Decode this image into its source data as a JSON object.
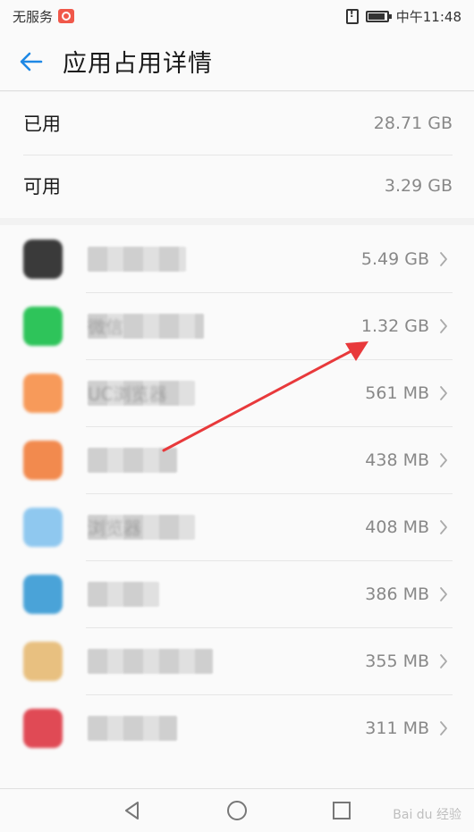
{
  "status_bar": {
    "carrier": "无服务",
    "time": "中午11:48"
  },
  "header": {
    "title": "应用占用详情"
  },
  "storage": [
    {
      "label": "已用",
      "value": "28.71 GB"
    },
    {
      "label": "可用",
      "value": "3.29 GB"
    }
  ],
  "apps": [
    {
      "name": "",
      "size": "5.49 GB",
      "icon_color": "#3a3a3a",
      "icon_name": "qq-icon",
      "blur_width": 110
    },
    {
      "name": "微信",
      "size": "1.32 GB",
      "icon_color": "#2ec45a",
      "icon_name": "wechat-icon",
      "blur_width": 130
    },
    {
      "name": "UC浏览器",
      "size": "561 MB",
      "icon_color": "#f79a5a",
      "icon_name": "browser-icon",
      "blur_width": 120
    },
    {
      "name": "",
      "size": "438 MB",
      "icon_color": "#f28a4e",
      "icon_name": "app-icon",
      "blur_width": 100
    },
    {
      "name": "浏览器",
      "size": "408 MB",
      "icon_color": "#8fc8ef",
      "icon_name": "browser-icon",
      "blur_width": 120
    },
    {
      "name": "",
      "size": "386 MB",
      "icon_color": "#4aa3d8",
      "icon_name": "app-icon",
      "blur_width": 80
    },
    {
      "name": "",
      "size": "355 MB",
      "icon_color": "#e8c080",
      "icon_name": "app-icon",
      "blur_width": 140
    },
    {
      "name": "",
      "size": "311 MB",
      "icon_color": "#e04a55",
      "icon_name": "app-icon",
      "blur_width": 100
    }
  ],
  "colors": {
    "accent": "#1e88e5",
    "annotation_arrow": "#e8393b"
  },
  "watermark": "Bai du 经验"
}
